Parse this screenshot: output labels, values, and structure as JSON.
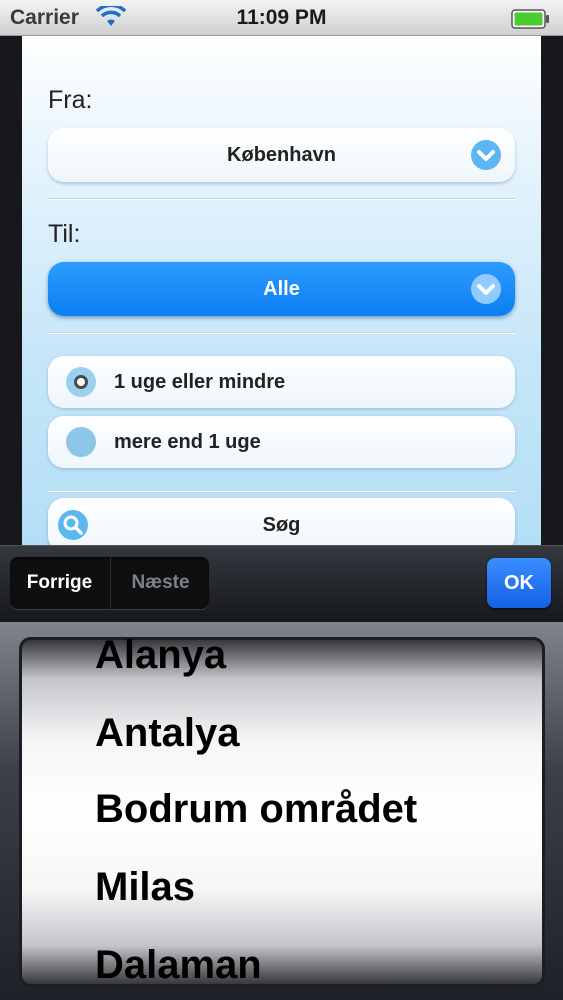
{
  "status_bar": {
    "carrier": "Carrier",
    "time": "11:09 PM"
  },
  "form": {
    "from_label": "Fra:",
    "from_value": "København",
    "to_label": "Til:",
    "to_value": "Alle",
    "duration_options": [
      {
        "label": "1 uge eller mindre",
        "checked": true
      },
      {
        "label": "mere end 1 uge",
        "checked": false
      }
    ],
    "search_label": "Søg"
  },
  "toolbar": {
    "previous_label": "Forrige",
    "next_label": "Næste",
    "ok_label": "OK"
  },
  "picker": {
    "items": [
      "Alanya",
      "Antalya",
      "Bodrum området",
      "Milas",
      "Dalaman"
    ]
  },
  "colors": {
    "accent_blue": "#0a7ff0",
    "ok_blue": "#1661e6",
    "content_bg": "#c8e7f8"
  }
}
